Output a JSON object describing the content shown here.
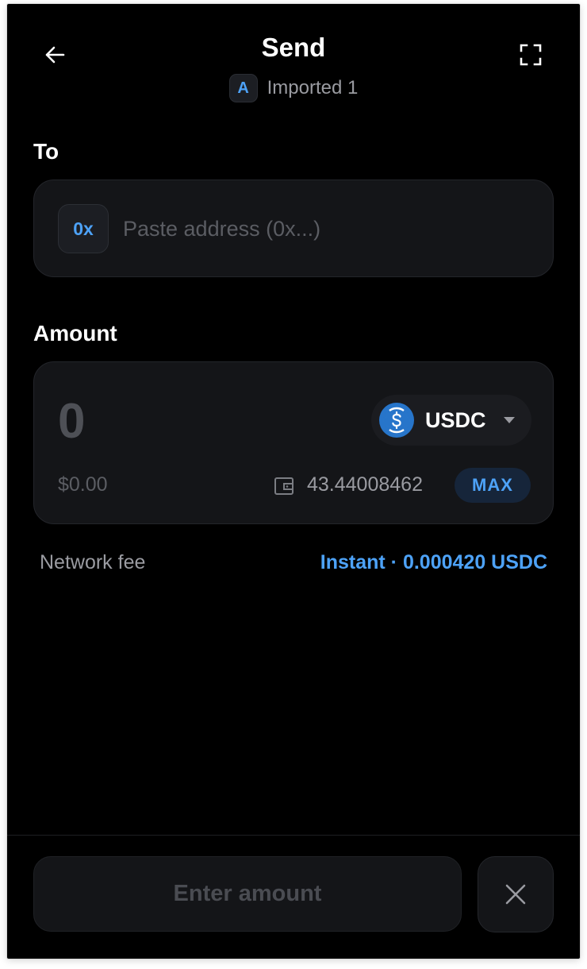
{
  "header": {
    "title": "Send",
    "account_badge": "A",
    "account_name": "Imported 1"
  },
  "to": {
    "label": "To",
    "prefix": "0x",
    "placeholder": "Paste address (0x...)"
  },
  "amount": {
    "label": "Amount",
    "placeholder": "0",
    "token": "USDC",
    "fiat_value": "$0.00",
    "balance": "43.44008462",
    "max_label": "MAX"
  },
  "fee": {
    "label": "Network fee",
    "value": "Instant · 0.000420 USDC"
  },
  "footer": {
    "primary_label": "Enter amount"
  },
  "icons": {
    "back": "arrow-left-icon",
    "expand": "expand-icon",
    "token": "usdc-logo-icon",
    "wallet": "wallet-icon",
    "close": "close-icon"
  },
  "colors": {
    "background": "#000000",
    "card": "#141518",
    "accent": "#4da2f7",
    "usdc": "#2775ca"
  }
}
